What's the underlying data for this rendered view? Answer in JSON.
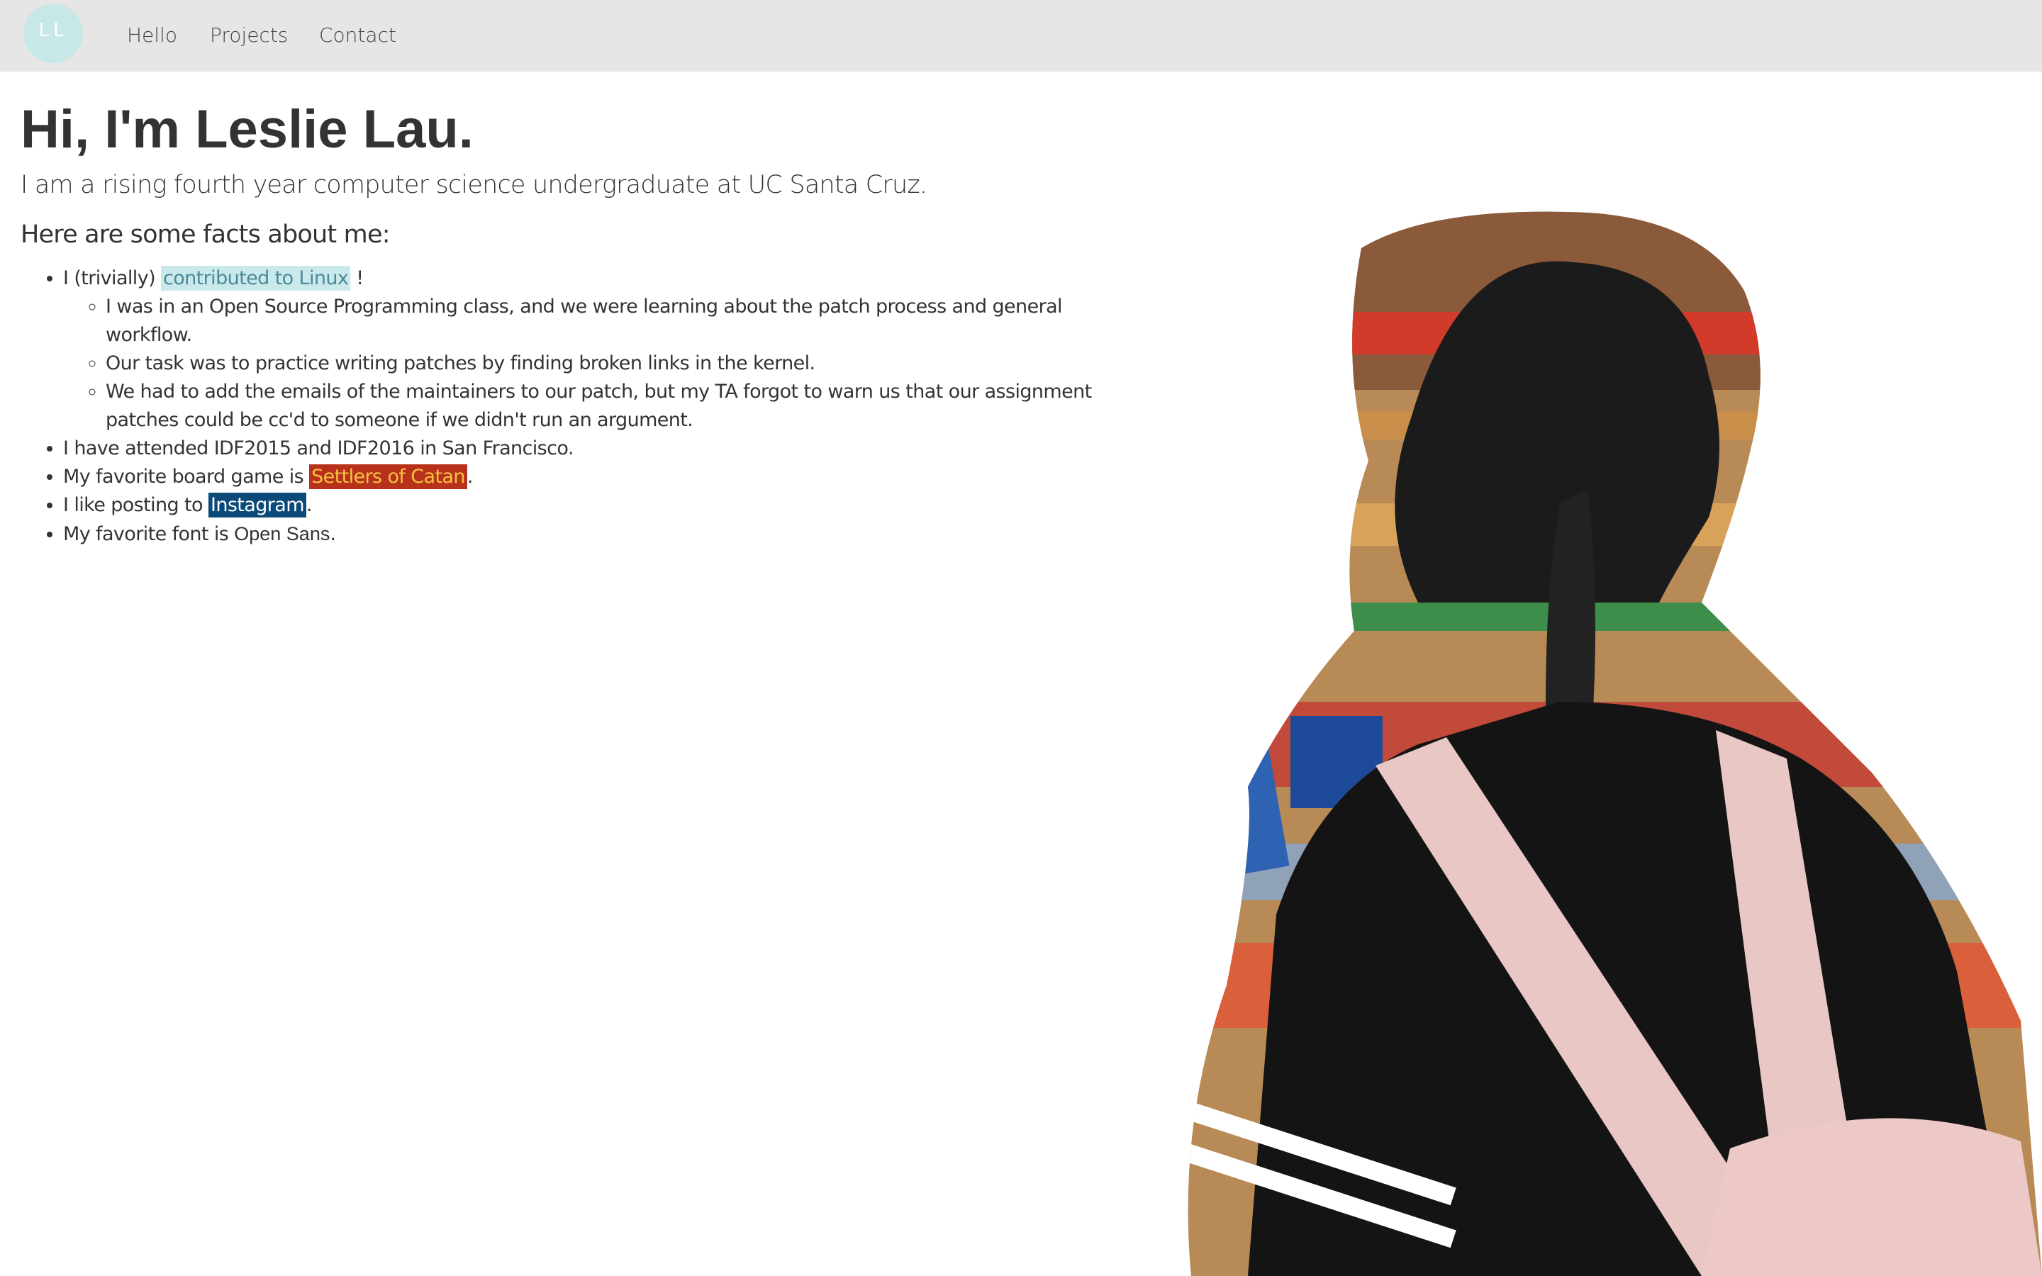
{
  "nav": {
    "logo_text": "LL",
    "links": [
      "Hello",
      "Projects",
      "Contact"
    ]
  },
  "main": {
    "title": "Hi, I'm Leslie Lau.",
    "intro": "I am a rising fourth year computer science undergraduate at UC Santa Cruz.",
    "facts_heading": "Here are some facts about me:",
    "facts": {
      "linux_prefix": "I (trivially) ",
      "linux_link": "contributed to Linux",
      "linux_suffix": " !",
      "linux_subitems": [
        "I was in an Open Source Programming class, and we were learning about the patch process and general workflow.",
        "Our task was to practice writing patches by finding broken links in the kernel.",
        "We had to add the emails of the maintainers to our patch, but my TA forgot to warn us that our assignment patches could be cc'd to someone if we didn't run an argument."
      ],
      "idf": "I have attended IDF2015 and IDF2016 in San Francisco.",
      "catan_prefix": "My favorite board game is ",
      "catan_link": "Settlers of Catan",
      "catan_suffix": ".",
      "insta_prefix": "I like posting to ",
      "insta_link": "Instagram",
      "insta_suffix": ".",
      "font_prefix": "My favorite font is ",
      "font_name": "Open Sans",
      "font_suffix": "."
    }
  },
  "colors": {
    "navbar_bg": "#e6e6e6",
    "logo_bg": "#c8e8e8",
    "linux_highlight": "#c9e9ea",
    "catan_highlight": "#b8321b",
    "catan_text": "#f5c242",
    "instagram_highlight": "#0a4a78"
  },
  "photo": {
    "icon": "photo-of-woman-in-grocery-aisle"
  }
}
